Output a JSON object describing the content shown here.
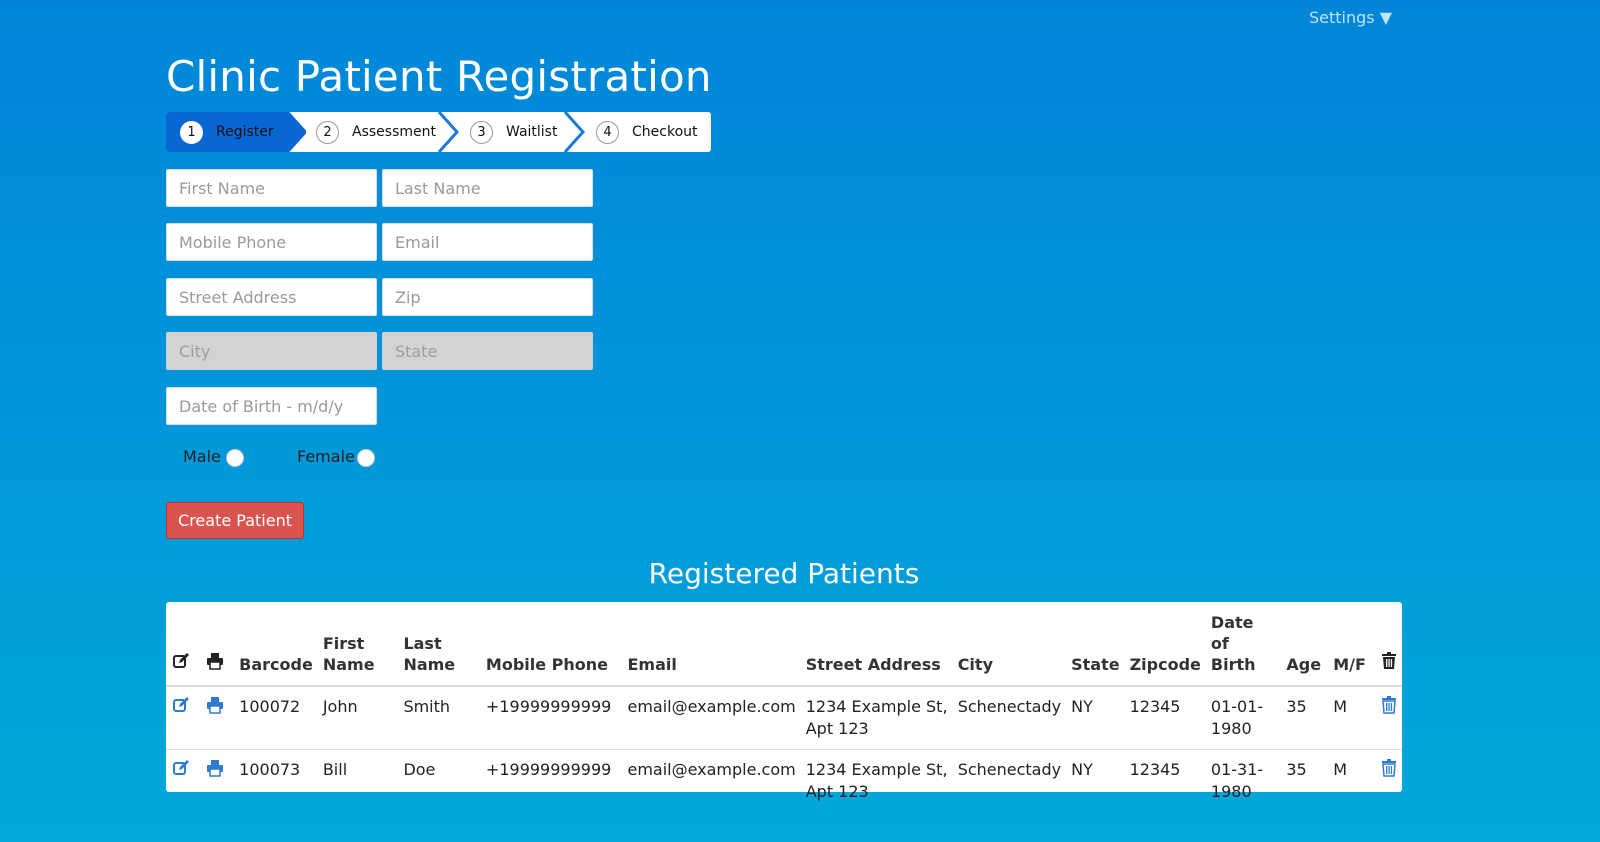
{
  "settings": {
    "label": "Settings ▼"
  },
  "page": {
    "title": "Clinic Patient Registration"
  },
  "wizard": {
    "steps": [
      {
        "number": "1",
        "label": "Register",
        "active": true
      },
      {
        "number": "2",
        "label": "Assessment"
      },
      {
        "number": "3",
        "label": "Waitlist"
      },
      {
        "number": "4",
        "label": "Checkout"
      }
    ]
  },
  "form": {
    "first_name": {
      "placeholder": "First Name"
    },
    "last_name": {
      "placeholder": "Last Name"
    },
    "mobile_phone": {
      "placeholder": "Mobile Phone"
    },
    "email": {
      "placeholder": "Email"
    },
    "street_address": {
      "placeholder": "Street Address"
    },
    "zip": {
      "placeholder": "Zip"
    },
    "city": {
      "placeholder": "City"
    },
    "state": {
      "placeholder": "State"
    },
    "dob": {
      "placeholder": "Date of Birth - m/d/y"
    },
    "gender_options": [
      "Male",
      "Female"
    ],
    "submit_label": "Create Patient"
  },
  "registered": {
    "title": "Registered Patients",
    "columns": [
      "Barcode",
      "First Name",
      "Last Name",
      "Mobile Phone",
      "Email",
      "Street Address",
      "City",
      "State",
      "Zipcode",
      "Date of Birth",
      "Age",
      "M/F"
    ],
    "rows": [
      [
        "100072",
        "John",
        "Smith",
        "+19999999999",
        "email@example.com",
        "1234 Example St, Apt 123",
        "Schenectady",
        "NY",
        "12345",
        "01-01-1980",
        "35",
        "M"
      ],
      [
        "100073",
        "Bill",
        "Doe",
        "+19999999999",
        "email@example.com",
        "1234 Example St, Apt 123",
        "Schenectady",
        "NY",
        "12345",
        "01-31-1980",
        "35",
        "M"
      ]
    ]
  },
  "icons": {
    "edit": "edit-icon",
    "print": "print-icon",
    "delete": "trash-icon"
  },
  "colors": {
    "accent": "#0867d4",
    "danger": "#d9534f",
    "icon_blue": "#2f7bd0"
  }
}
